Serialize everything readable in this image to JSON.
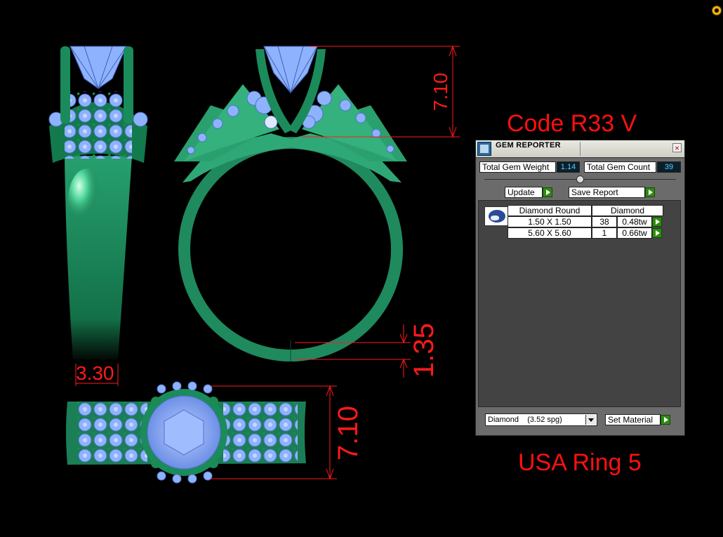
{
  "labels": {
    "code": "Code R33 V",
    "size": "USA Ring 5"
  },
  "dimensions": {
    "side_height": "7.10",
    "shank_thickness": "1.35",
    "shank_width": "3.30",
    "top_width": "7.10"
  },
  "gem_reporter": {
    "title": "GEM REPORTER",
    "total_weight_label": "Total Gem Weight",
    "total_weight_value": "1.14",
    "total_count_label": "Total Gem Count",
    "total_count_value": "39",
    "update_label": "Update",
    "save_report_label": "Save Report",
    "table": {
      "headers": [
        "Diamond Round",
        "Diamond"
      ],
      "rows": [
        {
          "size": "1.50 X 1.50",
          "count": "38",
          "weight": "0.48tw"
        },
        {
          "size": "5.60 X 5.60",
          "count": "1",
          "weight": "0.66tw"
        }
      ]
    },
    "material_selected": "Diamond    (3.52 spg)",
    "set_material_label": "Set Material"
  },
  "colors": {
    "dimension_red": "#ff1a1a",
    "metal_green": "#1f8a5e",
    "gem_blue": "#8fb2ff",
    "background": "#000000"
  }
}
